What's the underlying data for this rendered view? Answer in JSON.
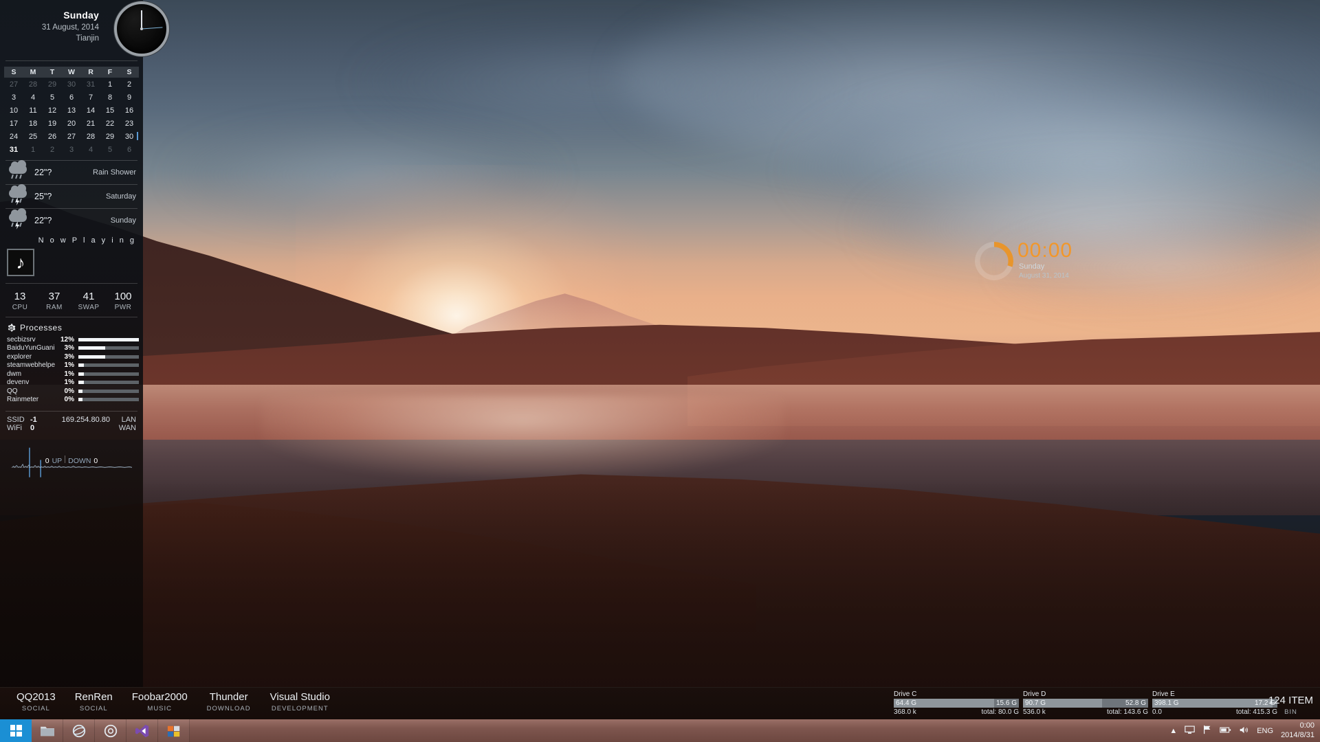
{
  "left_panel": {
    "clock": {
      "day": "Sunday",
      "date": "31 August, 2014",
      "city": "Tianjin"
    },
    "calendar": {
      "headers": [
        "S",
        "M",
        "T",
        "W",
        "R",
        "F",
        "S"
      ],
      "weeks": [
        [
          {
            "d": "27",
            "dim": true
          },
          {
            "d": "28",
            "dim": true
          },
          {
            "d": "29",
            "dim": true
          },
          {
            "d": "30",
            "dim": true
          },
          {
            "d": "31",
            "dim": true
          },
          {
            "d": "1"
          },
          {
            "d": "2"
          }
        ],
        [
          {
            "d": "3"
          },
          {
            "d": "4"
          },
          {
            "d": "5"
          },
          {
            "d": "6"
          },
          {
            "d": "7"
          },
          {
            "d": "8"
          },
          {
            "d": "9"
          }
        ],
        [
          {
            "d": "10"
          },
          {
            "d": "11"
          },
          {
            "d": "12"
          },
          {
            "d": "13"
          },
          {
            "d": "14"
          },
          {
            "d": "15"
          },
          {
            "d": "16"
          }
        ],
        [
          {
            "d": "17"
          },
          {
            "d": "18"
          },
          {
            "d": "19"
          },
          {
            "d": "20"
          },
          {
            "d": "21"
          },
          {
            "d": "22"
          },
          {
            "d": "23"
          }
        ],
        [
          {
            "d": "24"
          },
          {
            "d": "25"
          },
          {
            "d": "26"
          },
          {
            "d": "27"
          },
          {
            "d": "28"
          },
          {
            "d": "29"
          },
          {
            "d": "30",
            "marked": true
          }
        ],
        [
          {
            "d": "31",
            "today": true
          },
          {
            "d": "1",
            "dim": true
          },
          {
            "d": "2",
            "dim": true
          },
          {
            "d": "3",
            "dim": true
          },
          {
            "d": "4",
            "dim": true
          },
          {
            "d": "5",
            "dim": true
          },
          {
            "d": "6",
            "dim": true
          }
        ]
      ]
    },
    "weather": [
      {
        "temp": "22\"?",
        "label": "Rain Shower",
        "icon": "rain-shower-icon"
      },
      {
        "temp": "25\"?",
        "label": "Saturday",
        "icon": "thunderstorm-icon"
      },
      {
        "temp": "22\"?",
        "label": "Sunday",
        "icon": "thunderstorm-icon"
      }
    ],
    "now_playing": {
      "title": "N o w   P l a y i n g",
      "album_art_icon": "music-note-icon"
    },
    "stats": [
      {
        "value": "13",
        "label": "CPU"
      },
      {
        "value": "37",
        "label": "RAM"
      },
      {
        "value": "41",
        "label": "SWAP"
      },
      {
        "value": "100",
        "label": "PWR"
      }
    ],
    "processes": {
      "title": "Processes",
      "icon": "gear-icon",
      "rows": [
        {
          "name": "secbizsrv",
          "pct": "12%",
          "fill": 100
        },
        {
          "name": "BaiduYunGuaniia",
          "pct": "3%",
          "fill": 44
        },
        {
          "name": "explorer",
          "pct": "3%",
          "fill": 44
        },
        {
          "name": "steamwebhelper",
          "pct": "1%",
          "fill": 9
        },
        {
          "name": "dwm",
          "pct": "1%",
          "fill": 9
        },
        {
          "name": "devenv",
          "pct": "1%",
          "fill": 9
        },
        {
          "name": "QQ",
          "pct": "0%",
          "fill": 7
        },
        {
          "name": "Rainmeter",
          "pct": "0%",
          "fill": 7
        }
      ]
    },
    "network": {
      "ssid_label": "SSID",
      "ssid_value": "-1",
      "wifi_label": "WiFi",
      "wifi_value": "0",
      "ip": "169.254.80.80",
      "lan_tag": "LAN",
      "wan_tag": "WAN",
      "up_value": "0",
      "up_label": "UP",
      "down_label": "DOWN",
      "down_value": "0"
    }
  },
  "right_clock": {
    "time": "00:00",
    "day": "Sunday",
    "date": "August 31, 2014",
    "accent": "#f2972a"
  },
  "dock": {
    "apps": [
      {
        "name": "QQ2013",
        "category": "SOCIAL"
      },
      {
        "name": "RenRen",
        "category": "SOCIAL"
      },
      {
        "name": "Foobar2000",
        "category": "MUSIC"
      },
      {
        "name": "Thunder",
        "category": "DOWNLOAD"
      },
      {
        "name": "Visual Studio",
        "category": "DEVELOPMENT"
      }
    ],
    "drives": [
      {
        "name": "Drive C",
        "used": "64.4 G",
        "free": "15.6 G",
        "rate": "368.0 k",
        "total": "total: 80.0 G",
        "pct": 80
      },
      {
        "name": "Drive D",
        "used": "90.7 G",
        "free": "52.8 G",
        "rate": "536.0 k",
        "total": "total: 143.6 G",
        "pct": 63
      },
      {
        "name": "Drive E",
        "used": "398.1 G",
        "free": "17.2 G",
        "rate": "0.0",
        "total": "total: 415.3 G",
        "pct": 96
      }
    ],
    "recycle_bin": {
      "count": "124 ITEM",
      "label": "BIN"
    }
  },
  "taskbar": {
    "start_icon": "windows-logo-icon",
    "buttons": [
      {
        "icon": "folder-icon",
        "name": "file-explorer"
      },
      {
        "icon": "internet-explorer-icon",
        "name": "internet-explorer"
      },
      {
        "icon": "chrome-icon",
        "name": "chrome"
      },
      {
        "icon": "visual-studio-icon",
        "name": "visual-studio"
      },
      {
        "icon": "app-icon",
        "name": "pinned-app"
      }
    ],
    "tray": {
      "show_hidden_icon": "chevron-up-icon",
      "monitor_icon": "monitor-icon",
      "flag_icon": "flag-icon",
      "battery_icon": "battery-icon",
      "volume_icon": "volume-icon",
      "language": "ENG",
      "time": "0:00",
      "date": "2014/8/31"
    }
  }
}
